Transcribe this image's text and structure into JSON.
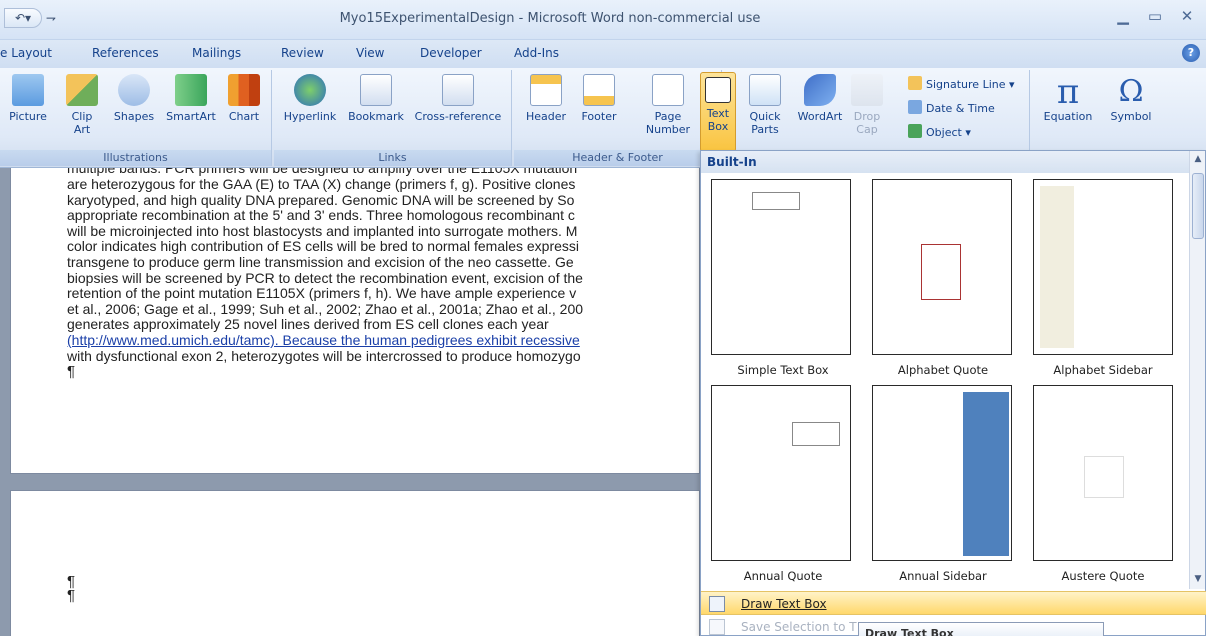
{
  "window": {
    "title_left": "Myo15ExperimentalDesign - Microsoft Word non-commercial use",
    "qat_undo": "↶▾",
    "qat_more": "⇁",
    "min": "▁",
    "max": "▭",
    "close": "✕"
  },
  "tabs": [
    "e Layout",
    "References",
    "Mailings",
    "Review",
    "View",
    "Developer",
    "Add-Ins"
  ],
  "help": "?",
  "ribbon": {
    "illustrations": {
      "label": "Illustrations",
      "buttons": [
        "Picture",
        "Clip\nArt",
        "Shapes",
        "SmartArt",
        "Chart"
      ]
    },
    "links": {
      "label": "Links",
      "buttons": [
        "Hyperlink",
        "Bookmark",
        "Cross-reference"
      ]
    },
    "header_footer": {
      "label": "Header & Footer",
      "buttons": [
        "Header",
        "Footer",
        "Page\nNumber"
      ]
    },
    "text": {
      "buttons": [
        "Text\nBox",
        "Quick\nParts",
        "WordArt",
        "Drop\nCap"
      ],
      "small": [
        "Signature Line",
        "Date & Time",
        "Object"
      ]
    },
    "symbols": {
      "buttons": [
        "Equation",
        "Symbol"
      ],
      "pi": "π",
      "omega": "Ω"
    }
  },
  "document": {
    "lines": [
      "multiple bands. PCR primers will be designed to amplify over the E1105X mutation",
      "are heterozygous for the GAA (E) to TAA (X) change (primers f, g). Positive clones",
      "karyotyped, and high quality DNA prepared. Genomic DNA will be screened by So",
      "appropriate recombination at the 5' and 3' ends. Three homologous recombinant c",
      "will be microinjected into host blastocysts and implanted into surrogate mothers. M",
      "color indicates high contribution of ES cells will be bred to normal females expressi",
      "transgene to produce germ line transmission and excision of the neo cassette. Ge",
      "biopsies will be screened by PCR to detect the recombination event, excision of the",
      "retention of the point mutation E1105X (primers f, h). We have ample experience v",
      "et al., 2006; Gage et al., 1999; Suh et al., 2002; Zhao et al., 2001a; Zhao et al., 200",
      "generates approximately 25 novel lines derived from ES cell clones each year",
      "(http://www.med.umich.edu/tamc). Because the human pedigrees exhibit recessive",
      "with dysfunctional exon 2, heterozygotes will be intercrossed to produce homozygo"
    ],
    "pilcrow": "¶",
    "page2_pilcrow": "¶"
  },
  "gallery": {
    "header": "Built-In",
    "items": [
      "Simple Text Box",
      "Alphabet Quote",
      "Alphabet Sidebar",
      "Annual Quote",
      "Annual Sidebar",
      "Austere Quote"
    ],
    "menu": [
      "Draw Text Box",
      "Save Selection to T"
    ],
    "tooltip": "Draw Text Box"
  },
  "colors": {
    "ribbon_text": "#15428b",
    "hot_item": "#ffd86c",
    "sidebar_blue": "#4f81bd"
  }
}
